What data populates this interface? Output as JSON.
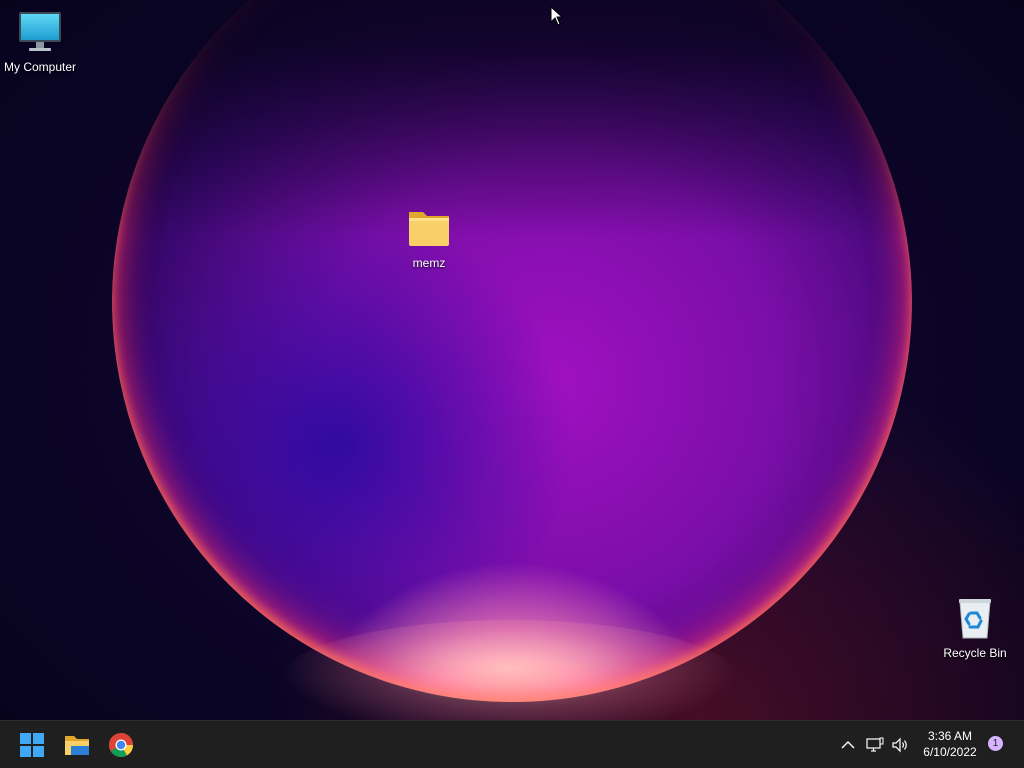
{
  "desktop": {
    "icons": [
      {
        "label": "My Computer",
        "icon": "monitor-icon"
      },
      {
        "label": "memz",
        "icon": "folder-icon"
      },
      {
        "label": "Recycle Bin",
        "icon": "recycle-bin-icon"
      }
    ]
  },
  "taskbar": {
    "apps": [
      {
        "name": "start",
        "icon": "windows-logo-icon"
      },
      {
        "name": "file-explorer",
        "icon": "folder-icon"
      },
      {
        "name": "chrome",
        "icon": "chrome-icon"
      }
    ],
    "tray": {
      "icons": [
        "chevron-up-icon",
        "network-icon",
        "speaker-icon"
      ],
      "time": "3:36 AM",
      "date": "6/10/2022",
      "notification_count": "1"
    }
  },
  "colors": {
    "taskbar_bg": "#1f1f1f",
    "windows_blue": "#3fa9f5",
    "folder_yellow": "#f6c64d",
    "badge": "#d6b4ff"
  }
}
